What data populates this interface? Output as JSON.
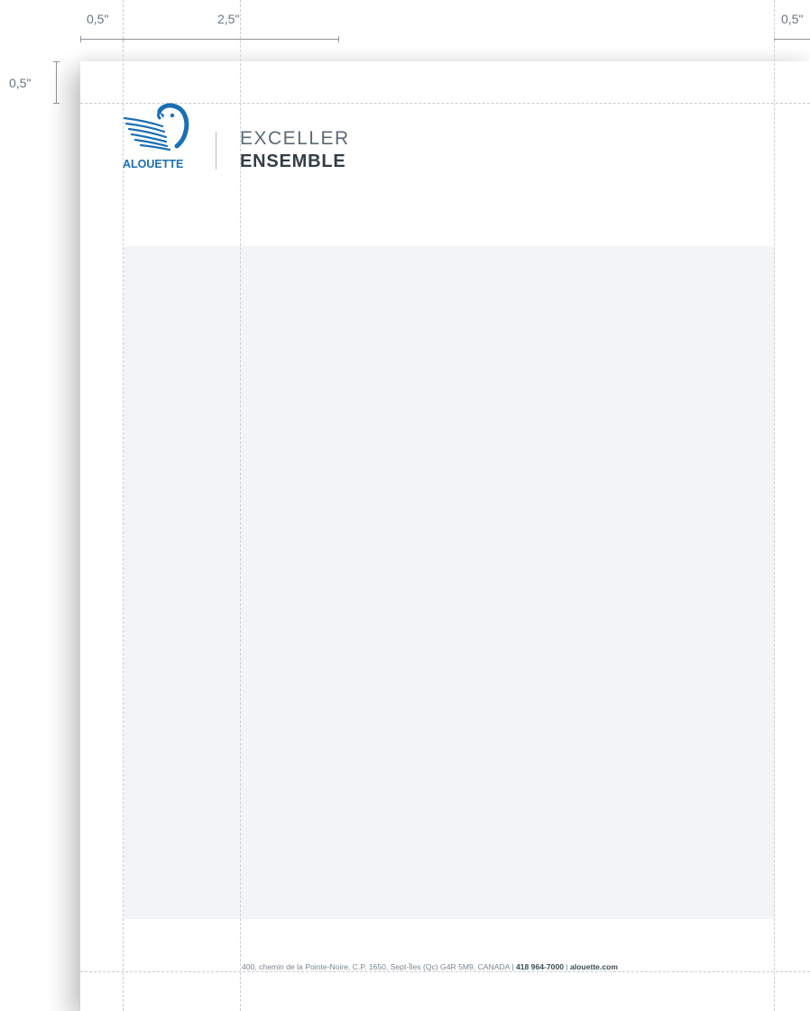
{
  "dimensions": {
    "left_margin_label": "0,5\"",
    "column_width_label": "2,5\"",
    "right_margin_label": "0,5\"",
    "top_margin_label": "0,5\""
  },
  "brand": {
    "logo_name": "ALOUETTE",
    "logo_icon": "bird-wing-logo",
    "tagline_line1": "EXCELLER",
    "tagline_line2": "ENSEMBLE",
    "color_primary": "#1b6fb3",
    "color_text_dark": "#333d47",
    "color_text_light": "#5e6a75"
  },
  "footer": {
    "address": "400, chemin de la Pointe-Noire, C.P. 1650, Sept-Îles (Qc) G4R 5M9, CANADA |",
    "phone": "418 964-7000",
    "separator": "|",
    "website": "alouette.com"
  },
  "colors": {
    "content_area": "#f3f4f6",
    "guides": "#c9cdd1"
  }
}
